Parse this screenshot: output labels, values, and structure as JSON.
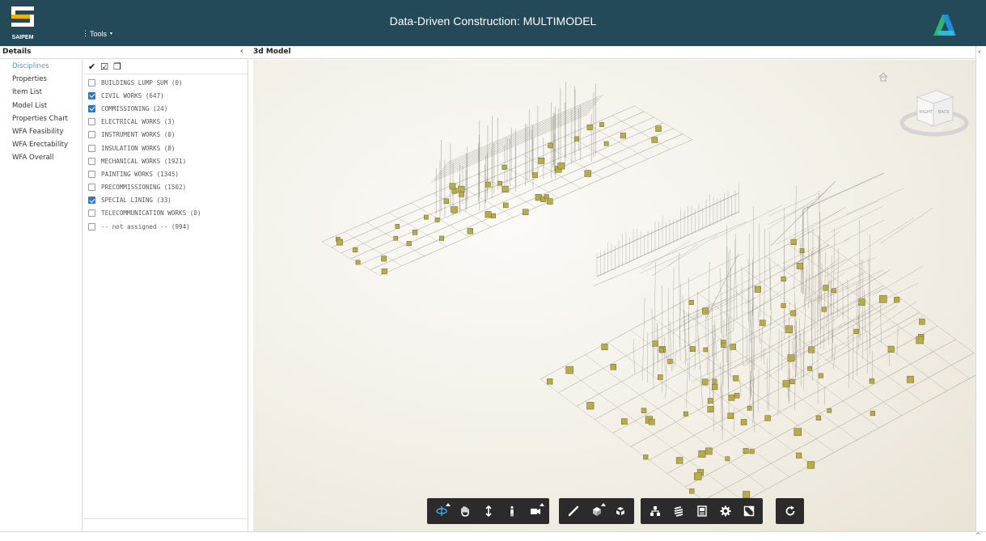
{
  "header": {
    "logo_text": "SAIPEM",
    "tools_label": "Tools",
    "title": "Data-Driven Construction: MULTIMODEL",
    "brand_icon": "autodesk-logo-icon"
  },
  "details": {
    "title": "Details",
    "collapse_glyph": "‹",
    "nav_items": [
      {
        "label": "Disciplines",
        "active": true
      },
      {
        "label": "Properties"
      },
      {
        "label": "Item List"
      },
      {
        "label": "Model List"
      },
      {
        "label": "Properties Chart"
      },
      {
        "label": "WFA Feasibility"
      },
      {
        "label": "WFA Erectability"
      },
      {
        "label": "WFA Overall"
      }
    ],
    "disciplines_toolbar": [
      "✔",
      "☑",
      "❐"
    ],
    "disciplines": [
      {
        "label": "BUILDINGS LUMP SUM (0)",
        "checked": false
      },
      {
        "label": "CIVIL WORKS (647)",
        "checked": true
      },
      {
        "label": "COMMISSIONING (24)",
        "checked": true
      },
      {
        "label": "ELECTRICAL WORKS (3)",
        "checked": false
      },
      {
        "label": "INSTRUMENT WORKS (0)",
        "checked": false
      },
      {
        "label": "INSULATION WORKS (8)",
        "checked": false
      },
      {
        "label": "MECHANICAL WORKS (1921)",
        "checked": false
      },
      {
        "label": "PAINTING WORKS (1345)",
        "checked": false
      },
      {
        "label": "PRECOMMISSIONING (1502)",
        "checked": false
      },
      {
        "label": "SPECIAL LINING (33)",
        "checked": true
      },
      {
        "label": "TELECOMMUNICATION WORKS (0)",
        "checked": false
      },
      {
        "label": "-- not assigned -- (994)",
        "checked": false
      }
    ]
  },
  "viewer": {
    "title": "3d Model",
    "viewcube_faces": [
      "RIGHT",
      "BACK"
    ],
    "toolbar_groups": [
      [
        {
          "name": "orbit-icon",
          "active": true,
          "more": true
        },
        {
          "name": "pan-icon"
        },
        {
          "name": "zoom-icon"
        },
        {
          "name": "first-person-icon"
        },
        {
          "name": "camera-icon",
          "more": true
        }
      ],
      [
        {
          "name": "measure-icon"
        },
        {
          "name": "section-icon",
          "more": true
        },
        {
          "name": "explode-icon"
        }
      ],
      [
        {
          "name": "model-browser-icon"
        },
        {
          "name": "properties-icon"
        },
        {
          "name": "document-browser-icon"
        },
        {
          "name": "settings-icon"
        },
        {
          "name": "fullscreen-icon"
        }
      ],
      [
        {
          "name": "reset-icon"
        }
      ]
    ]
  },
  "colors": {
    "header_bg": "#244a5a",
    "accent": "#4b9fd5",
    "checkbox_on": "#2a79c9",
    "toolbar_bg": "#2b2b2b",
    "model_line": "#8a8a5a",
    "model_node": "#b8ab4a"
  }
}
